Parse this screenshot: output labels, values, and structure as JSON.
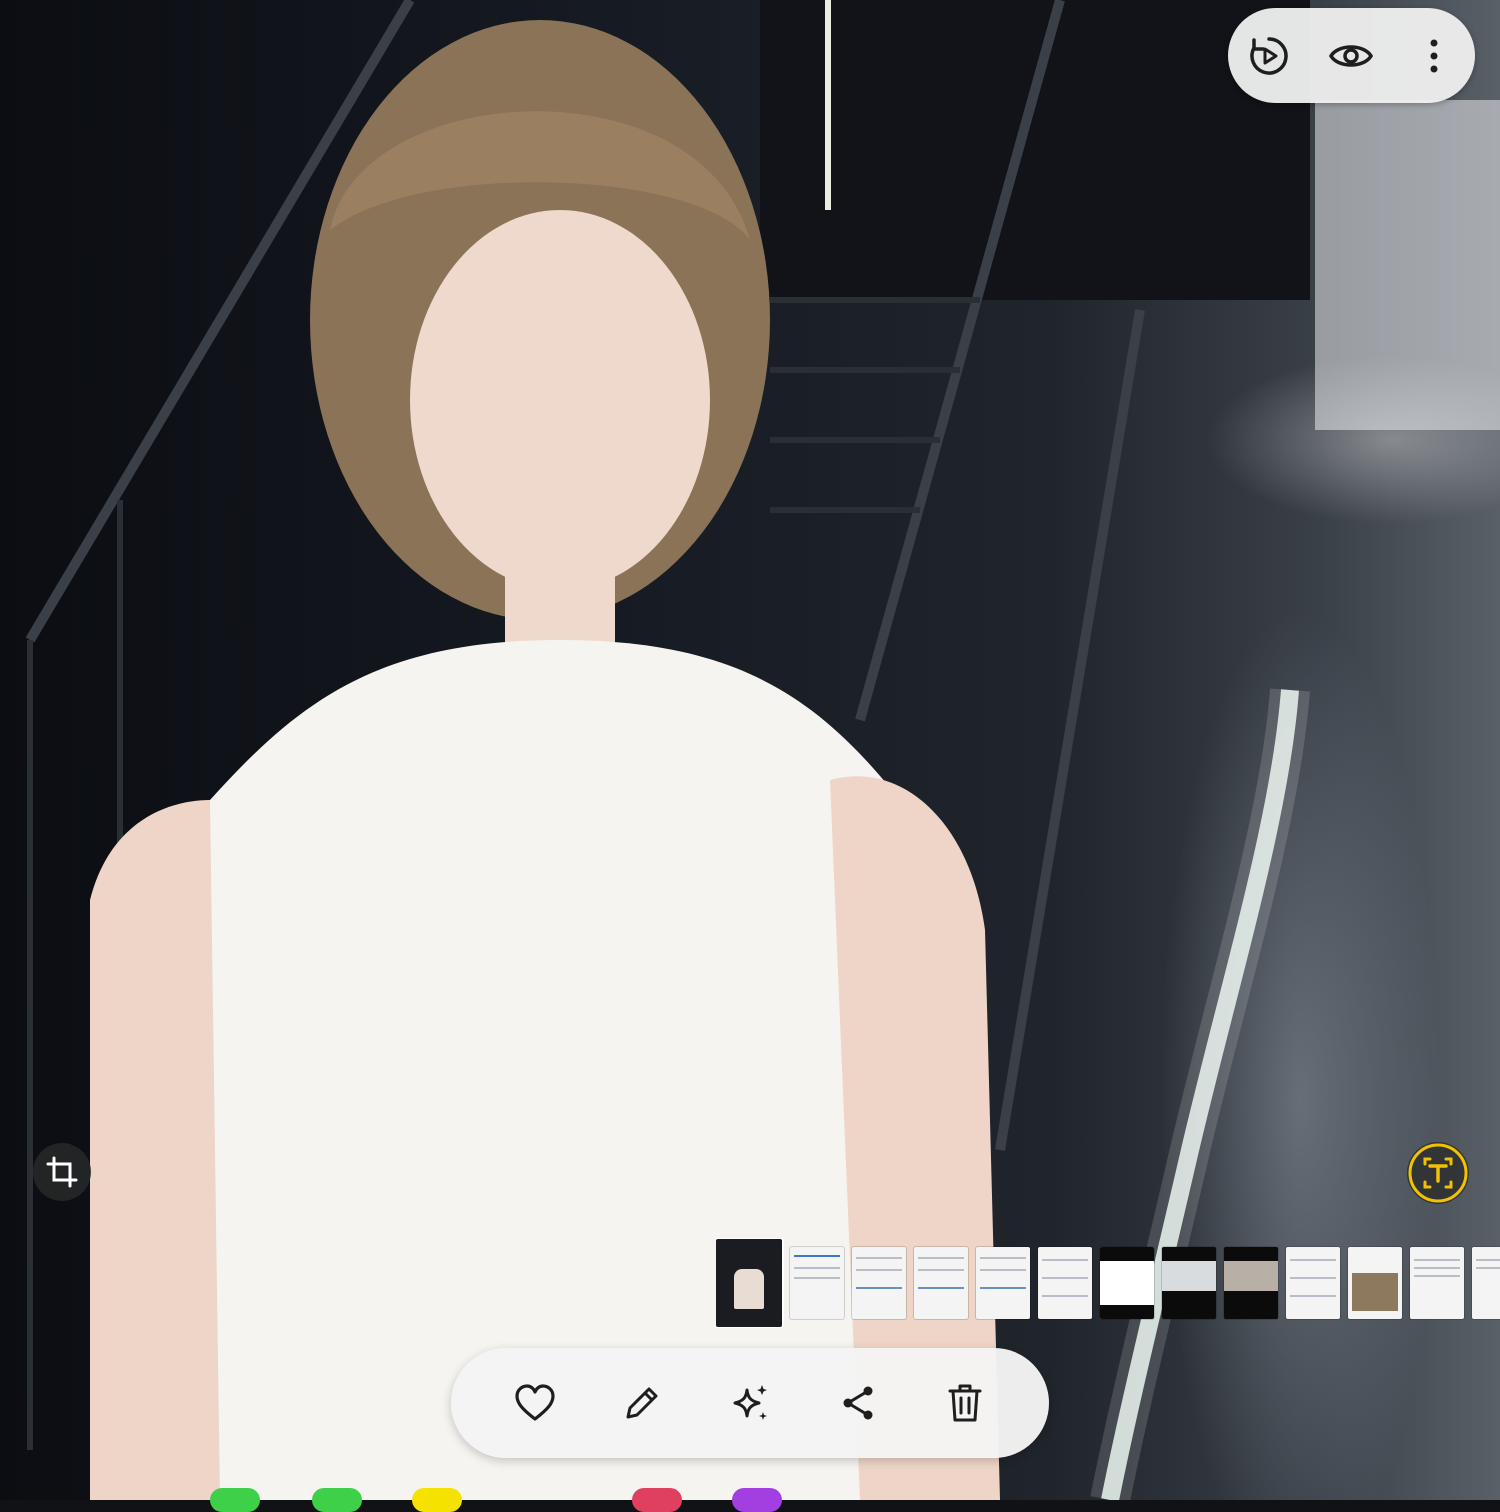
{
  "app": "gallery-photo-viewer",
  "colors": {
    "toolbar_bg": "#f4f4f4",
    "icon": "#1e1e1e",
    "text_extract_accent": "#f2c200",
    "crop_button_bg": "#282828"
  },
  "top_bar": {
    "icons": [
      "motion-photo-icon",
      "view-icon",
      "more-options-icon"
    ]
  },
  "overlay_buttons": {
    "left": "crop-icon",
    "right": "extract-text-icon"
  },
  "thumbnail_strip": {
    "current_index": 0,
    "count": 13
  },
  "bottom_toolbar": {
    "icons": [
      "favorite-icon",
      "edit-icon",
      "ai-effects-icon",
      "share-icon",
      "delete-icon"
    ]
  },
  "dock_app_colors": [
    "#3fd04a",
    "#3fd04a",
    "#f5e200",
    "#e04060",
    "#a33fe0"
  ]
}
